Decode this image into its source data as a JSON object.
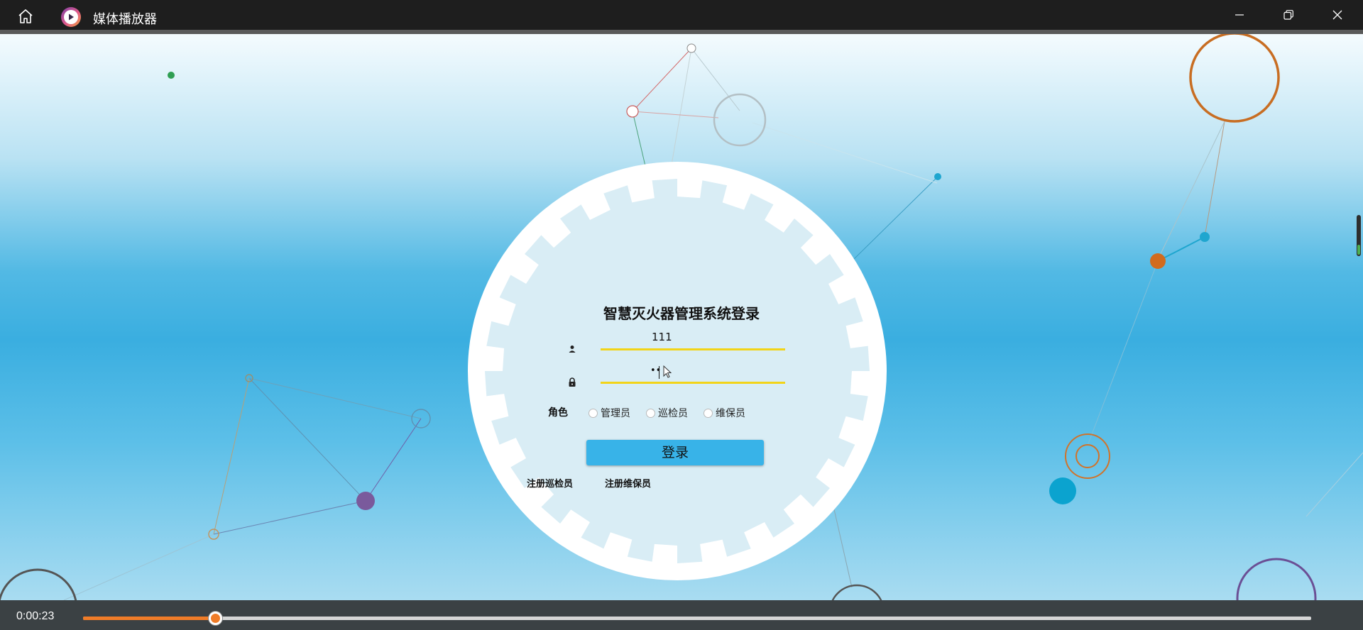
{
  "window": {
    "title": "媒体播放器",
    "icons": {
      "home": "home-icon",
      "app": "media-player-app-icon",
      "minimize": "minimize-icon",
      "restore": "restore-icon",
      "close": "close-icon"
    }
  },
  "login": {
    "title": "智慧灭火器管理系统登录",
    "username_value": "111",
    "password_value": "••",
    "role_label": "角色",
    "roles": [
      "管理员",
      "巡检员",
      "维保员"
    ],
    "login_button": "登录",
    "register_inspector": "注册巡检员",
    "register_maintainer": "注册维保员",
    "field_underline_color": "#f2d418",
    "button_color": "#38b3e8"
  },
  "player": {
    "current_time": "0:00:23",
    "progress": 0.108,
    "accent_color": "#f07c28"
  }
}
